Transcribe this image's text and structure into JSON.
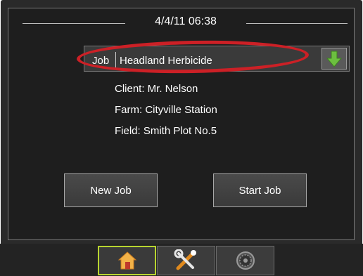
{
  "header": {
    "datetime": "4/4/11 06:38"
  },
  "job": {
    "label": "Job",
    "value": "Headland Herbicide"
  },
  "info": {
    "client": "Client: Mr. Nelson",
    "farm": "Farm: Cityville Station",
    "field": "Field: Smith Plot No.5"
  },
  "buttons": {
    "new_job": "New Job",
    "start_job": "Start Job"
  },
  "tabs": [
    {
      "name": "home",
      "icon": "home-icon",
      "active": true
    },
    {
      "name": "tools",
      "icon": "tools-icon",
      "active": false
    },
    {
      "name": "gauge",
      "icon": "gauge-icon",
      "active": false
    }
  ],
  "colors": {
    "accent": "#b8d430",
    "arrow": "#6cbf3f",
    "highlight": "#cc2026"
  }
}
